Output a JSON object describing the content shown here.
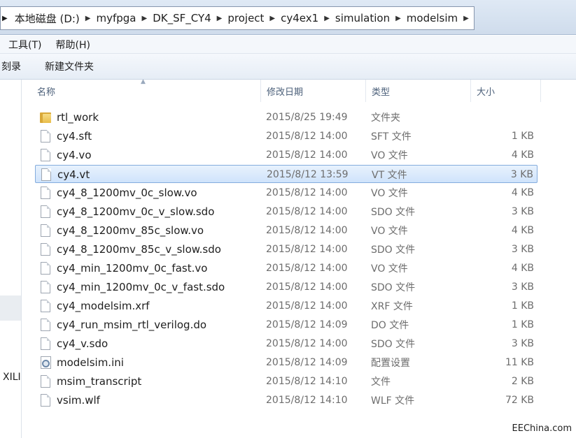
{
  "address_bar": {
    "crumbs": [
      "本地磁盘 (D:)",
      "myfpga",
      "DK_SF_CY4",
      "project",
      "cy4ex1",
      "simulation",
      "modelsim"
    ]
  },
  "menu": {
    "tools": "工具(T)",
    "help": "帮助(H)"
  },
  "toolbar": {
    "burn": "刻录",
    "new_folder": "新建文件夹"
  },
  "nav_pane": {
    "partial_label": "XILI"
  },
  "columns": {
    "name": "名称",
    "date": "修改日期",
    "type": "类型",
    "size": "大小"
  },
  "files": [
    {
      "name": "rtl_work",
      "date": "2015/8/25 19:49",
      "type": "文件夹",
      "size": "",
      "icon": "folder-icon"
    },
    {
      "name": "cy4.sft",
      "date": "2015/8/12 14:00",
      "type": "SFT 文件",
      "size": "1 KB",
      "icon": "file-icon"
    },
    {
      "name": "cy4.vo",
      "date": "2015/8/12 14:00",
      "type": "VO 文件",
      "size": "4 KB",
      "icon": "file-icon"
    },
    {
      "name": "cy4.vt",
      "date": "2015/8/12 13:59",
      "type": "VT 文件",
      "size": "3 KB",
      "icon": "file-icon",
      "selected": true
    },
    {
      "name": "cy4_8_1200mv_0c_slow.vo",
      "date": "2015/8/12 14:00",
      "type": "VO 文件",
      "size": "4 KB",
      "icon": "file-icon"
    },
    {
      "name": "cy4_8_1200mv_0c_v_slow.sdo",
      "date": "2015/8/12 14:00",
      "type": "SDO 文件",
      "size": "3 KB",
      "icon": "file-icon"
    },
    {
      "name": "cy4_8_1200mv_85c_slow.vo",
      "date": "2015/8/12 14:00",
      "type": "VO 文件",
      "size": "4 KB",
      "icon": "file-icon"
    },
    {
      "name": "cy4_8_1200mv_85c_v_slow.sdo",
      "date": "2015/8/12 14:00",
      "type": "SDO 文件",
      "size": "3 KB",
      "icon": "file-icon"
    },
    {
      "name": "cy4_min_1200mv_0c_fast.vo",
      "date": "2015/8/12 14:00",
      "type": "VO 文件",
      "size": "4 KB",
      "icon": "file-icon"
    },
    {
      "name": "cy4_min_1200mv_0c_v_fast.sdo",
      "date": "2015/8/12 14:00",
      "type": "SDO 文件",
      "size": "3 KB",
      "icon": "file-icon"
    },
    {
      "name": "cy4_modelsim.xrf",
      "date": "2015/8/12 14:00",
      "type": "XRF 文件",
      "size": "1 KB",
      "icon": "file-icon"
    },
    {
      "name": "cy4_run_msim_rtl_verilog.do",
      "date": "2015/8/12 14:09",
      "type": "DO 文件",
      "size": "1 KB",
      "icon": "file-icon"
    },
    {
      "name": "cy4_v.sdo",
      "date": "2015/8/12 14:00",
      "type": "SDO 文件",
      "size": "3 KB",
      "icon": "file-icon"
    },
    {
      "name": "modelsim.ini",
      "date": "2015/8/12 14:09",
      "type": "配置设置",
      "size": "11 KB",
      "icon": "settings-file-icon"
    },
    {
      "name": "msim_transcript",
      "date": "2015/8/12 14:10",
      "type": "文件",
      "size": "2 KB",
      "icon": "file-icon"
    },
    {
      "name": "vsim.wlf",
      "date": "2015/8/12 14:10",
      "type": "WLF 文件",
      "size": "72 KB",
      "icon": "file-icon"
    }
  ],
  "watermark": "EEChina.com"
}
